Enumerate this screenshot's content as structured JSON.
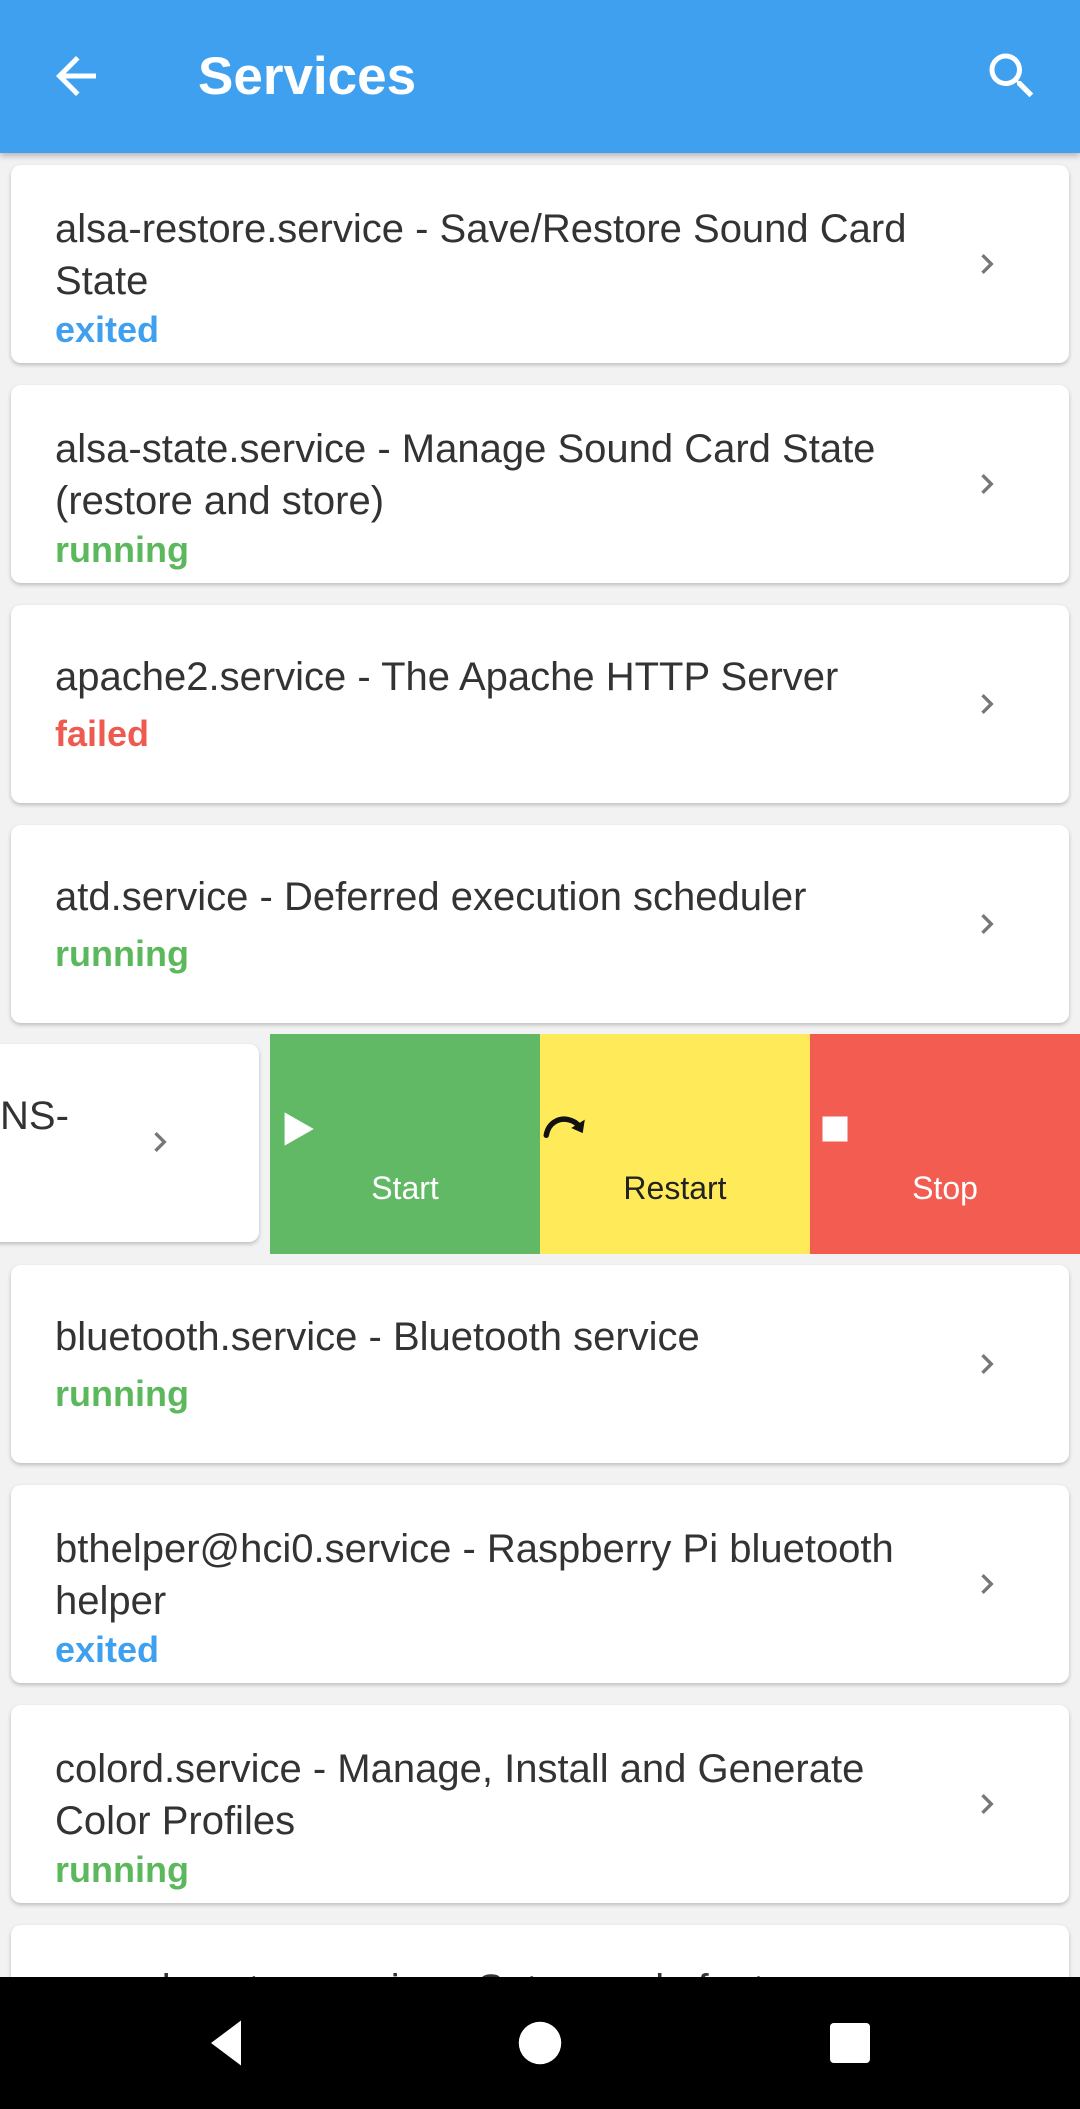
{
  "appbar": {
    "title": "Services",
    "back_icon": "arrow-left-icon",
    "search_icon": "search-icon",
    "color": "#3ea0ef"
  },
  "services": [
    {
      "name": "alsa-restore.service - Save/Restore Sound Card State",
      "status": "exited"
    },
    {
      "name": "alsa-state.service - Manage Sound Card State (restore and store)",
      "status": "running"
    },
    {
      "name": "apache2.service - The Apache HTTP Server",
      "status": "failed"
    },
    {
      "name": "atd.service - Deferred execution scheduler",
      "status": "running"
    },
    {
      "name": "bluetooth.service - Bluetooth service",
      "status": "running"
    },
    {
      "name": "bthelper@hci0.service - Raspberry Pi bluetooth helper",
      "status": "exited"
    },
    {
      "name": "colord.service - Manage, Install and Generate Color Profiles",
      "status": "running"
    },
    {
      "name": "console-setup.service - Set console font",
      "status": ""
    }
  ],
  "swiped_item": {
    "name_fragment": "NS-"
  },
  "actions": {
    "start": {
      "label": "Start",
      "icon": "play-icon",
      "color": "#62b965"
    },
    "restart": {
      "label": "Restart",
      "icon": "restart-icon",
      "color": "#ffeb5a"
    },
    "stop": {
      "label": "Stop",
      "icon": "stop-icon",
      "color": "#f25c51"
    }
  },
  "status_colors": {
    "exited": "#3ea0ef",
    "running": "#5cb85c",
    "failed": "#ee5a4f"
  },
  "navbar": {
    "back": "nav-back-icon",
    "home": "nav-home-icon",
    "recents": "nav-recents-icon"
  }
}
